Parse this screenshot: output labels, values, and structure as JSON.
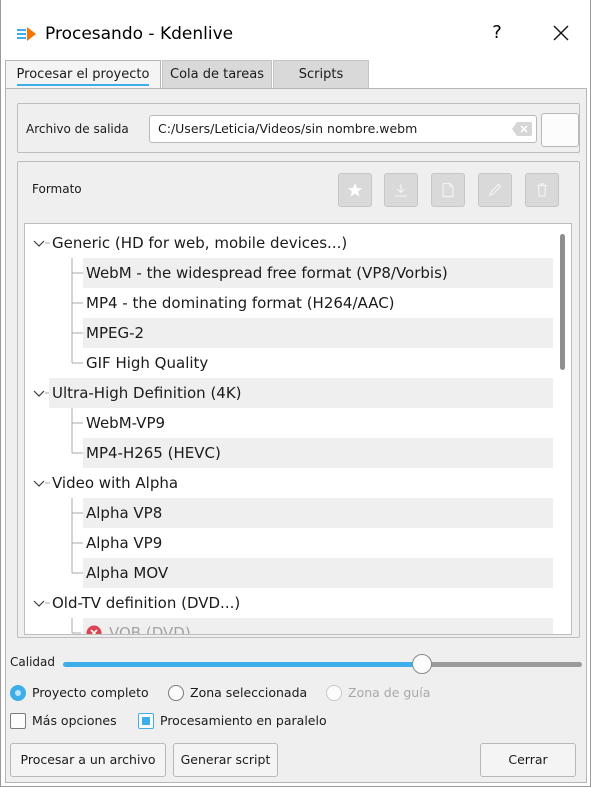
{
  "window": {
    "title": "Procesando - Kdenlive",
    "help_label": "?",
    "close_icon": "close-icon"
  },
  "tabs": [
    {
      "label": "Procesar el proyecto",
      "active": true
    },
    {
      "label": "Cola de tareas",
      "active": false
    },
    {
      "label": "Scripts",
      "active": false
    }
  ],
  "output": {
    "label": "Archivo de salida",
    "value": "C:/Users/Leticia/Videos/sin nombre.webm"
  },
  "format": {
    "label": "Formato",
    "toolbar_icons": [
      "star-icon",
      "download-icon",
      "new-document-icon",
      "edit-icon",
      "delete-icon"
    ]
  },
  "tree": {
    "rows": [
      {
        "label": "Generic (HD for web, mobile devices...)",
        "level": 0,
        "expanded": true,
        "shaded": false
      },
      {
        "label": "WebM - the widespread free format (VP8/Vorbis)",
        "level": 1,
        "shaded": true
      },
      {
        "label": "MP4 - the dominating format (H264/AAC)",
        "level": 1,
        "shaded": false
      },
      {
        "label": "MPEG-2",
        "level": 1,
        "shaded": true
      },
      {
        "label": "GIF High Quality",
        "level": 1,
        "shaded": false
      },
      {
        "label": "Ultra-High Definition (4K)",
        "level": 0,
        "expanded": true,
        "shaded": true
      },
      {
        "label": "WebM-VP9",
        "level": 1,
        "shaded": false
      },
      {
        "label": "MP4-H265 (HEVC)",
        "level": 1,
        "shaded": true
      },
      {
        "label": "Video with Alpha",
        "level": 0,
        "expanded": true,
        "shaded": false
      },
      {
        "label": "Alpha VP8",
        "level": 1,
        "shaded": true
      },
      {
        "label": "Alpha VP9",
        "level": 1,
        "shaded": false
      },
      {
        "label": "Alpha MOV",
        "level": 1,
        "shaded": true
      },
      {
        "label": "Old-TV definition (DVD...)",
        "level": 0,
        "expanded": true,
        "shaded": false
      },
      {
        "label": "VOB (DVD)",
        "level": 1,
        "shaded": true,
        "error": true
      }
    ]
  },
  "quality": {
    "label": "Calidad",
    "value_percent": 73
  },
  "range": {
    "options": [
      {
        "label": "Proyecto completo",
        "selected": true,
        "disabled": false
      },
      {
        "label": "Zona seleccionada",
        "selected": false,
        "disabled": false
      },
      {
        "label": "Zona de guía",
        "selected": false,
        "disabled": true
      }
    ]
  },
  "options": {
    "more": {
      "label": "Más opciones",
      "checked": false
    },
    "parallel": {
      "label": "Procesamiento en paralelo",
      "checked": true
    }
  },
  "buttons": {
    "render": "Procesar a un archivo",
    "script": "Generar script",
    "close": "Cerrar"
  },
  "colors": {
    "accent": "#3daee9",
    "error": "#da4453"
  }
}
